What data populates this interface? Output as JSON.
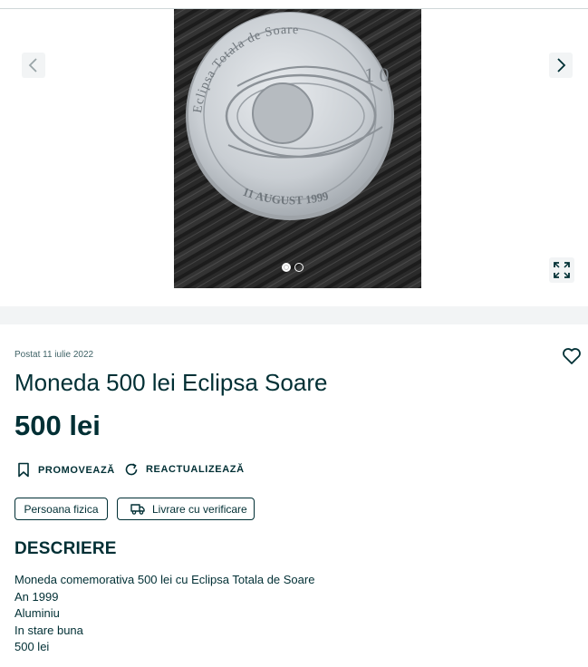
{
  "gallery": {
    "image_alt": "Moneda 500 lei Eclipsa Soare",
    "coin_text_top": "Eclipsa Totala de Soare",
    "coin_text_bottom": "11 AUGUST 1999",
    "slide_count": 2,
    "active_slide": 1
  },
  "listing": {
    "posted": "Postat 11 iulie 2022",
    "title": "Moneda 500 lei Eclipsa Soare",
    "price": "500 lei"
  },
  "actions": {
    "promote": "PROMOVEAZĂ",
    "refresh": "REACTUALIZEAZĂ"
  },
  "tags": {
    "person": "Persoana fizica",
    "delivery": "Livrare cu verificare"
  },
  "description": {
    "heading": "DESCRIERE",
    "lines": [
      "Moneda comemorativa 500 lei cu Eclipsa Totala de Soare",
      "An 1999",
      "Aluminiu",
      "In stare buna",
      "500 lei"
    ]
  },
  "icons": {
    "prev": "chevron-left-icon",
    "next": "chevron-right-icon",
    "expand": "expand-icon",
    "favorite": "heart-icon",
    "promote": "bookmark-icon",
    "refresh": "refresh-icon",
    "delivery": "truck-icon"
  }
}
